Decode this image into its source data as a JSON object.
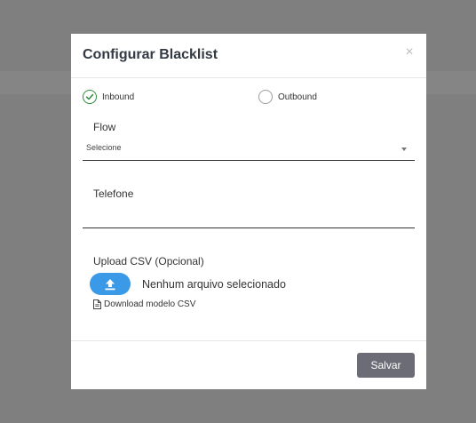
{
  "modal": {
    "title": "Configurar Blacklist",
    "close_symbol": "×"
  },
  "direction": {
    "selected": "Inbound",
    "options": [
      {
        "label": "Inbound",
        "checked": true
      },
      {
        "label": "Outbound",
        "checked": false
      }
    ]
  },
  "flow": {
    "label": "Flow",
    "selected_value": "Selecione"
  },
  "telefone": {
    "label": "Telefone",
    "value": ""
  },
  "upload": {
    "label": "Upload CSV (Opcional)",
    "file_status": "Nenhum arquivo selecionado",
    "download_label": "Download modelo CSV"
  },
  "footer": {
    "save_label": "Salvar"
  },
  "colors": {
    "backdrop": "#7f7f7f",
    "upload_button": "#3a9ae8",
    "save_button": "#6c6c77",
    "radio_checked": "#2e8b3c"
  },
  "icons": {
    "close": "close-icon",
    "check": "check-icon",
    "upload": "upload-icon",
    "file": "file-icon",
    "dropdown": "chevron-down-icon"
  }
}
